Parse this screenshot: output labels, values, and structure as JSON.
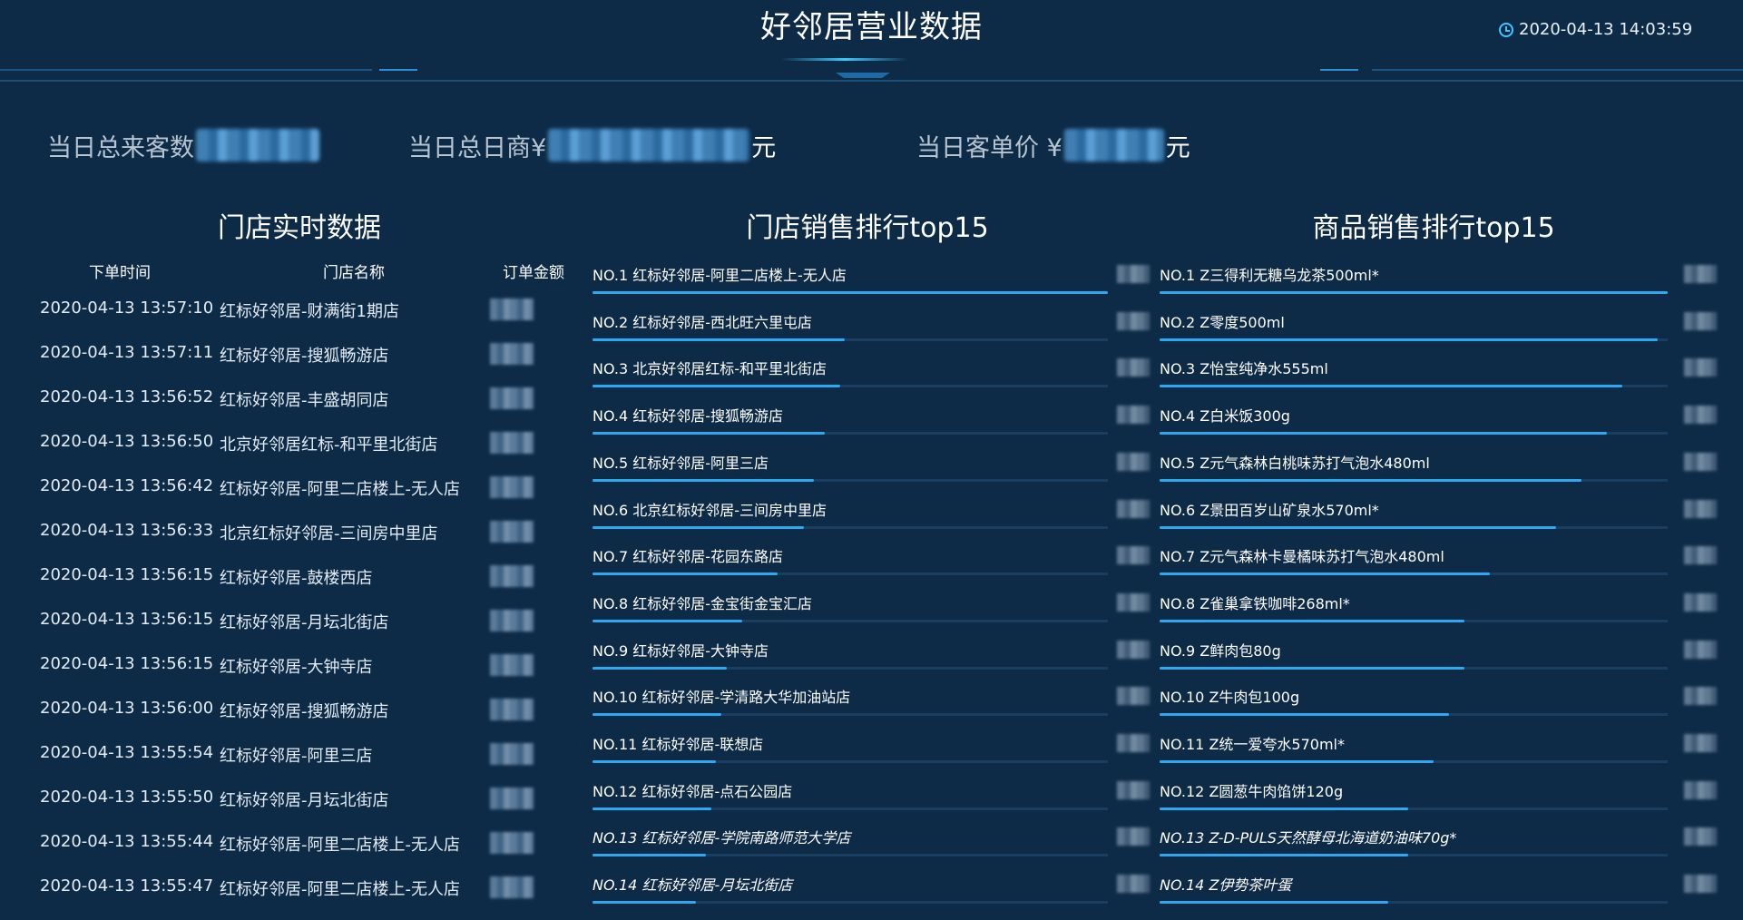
{
  "header": {
    "title": "好邻居营业数据",
    "datetime": "2020-04-13 14:03:59"
  },
  "summary": {
    "visitors_label": "当日总来客数",
    "revenue_label": "当日总日商¥",
    "revenue_unit": "元",
    "avg_label": "当日客单价 ¥",
    "avg_unit": "元"
  },
  "realtime": {
    "title": "门店实时数据",
    "columns": [
      "下单时间",
      "门店名称",
      "订单金额"
    ],
    "rows": [
      {
        "time": "2020-04-13 13:57:10",
        "store": "红标好邻居-财满街1期店"
      },
      {
        "time": "2020-04-13 13:57:11",
        "store": "红标好邻居-搜狐畅游店"
      },
      {
        "time": "2020-04-13 13:56:52",
        "store": "红标好邻居-丰盛胡同店"
      },
      {
        "time": "2020-04-13 13:56:50",
        "store": "北京好邻居红标-和平里北街店"
      },
      {
        "time": "2020-04-13 13:56:42",
        "store": "红标好邻居-阿里二店楼上-无人店"
      },
      {
        "time": "2020-04-13 13:56:33",
        "store": "北京红标好邻居-三间房中里店"
      },
      {
        "time": "2020-04-13 13:56:15",
        "store": "红标好邻居-鼓楼西店"
      },
      {
        "time": "2020-04-13 13:56:15",
        "store": "红标好邻居-月坛北街店"
      },
      {
        "time": "2020-04-13 13:56:15",
        "store": "红标好邻居-大钟寺店"
      },
      {
        "time": "2020-04-13 13:56:00",
        "store": "红标好邻居-搜狐畅游店"
      },
      {
        "time": "2020-04-13 13:55:54",
        "store": "红标好邻居-阿里三店"
      },
      {
        "time": "2020-04-13 13:55:50",
        "store": "红标好邻居-月坛北街店"
      },
      {
        "time": "2020-04-13 13:55:44",
        "store": "红标好邻居-阿里二店楼上-无人店"
      },
      {
        "time": "2020-04-13 13:55:47",
        "store": "红标好邻居-阿里二店楼上-无人店"
      }
    ]
  },
  "store_rank": {
    "title": "门店销售排行top15",
    "items": [
      {
        "label": "NO.1  红标好邻居-阿里二店楼上-无人店",
        "fill": 1.0
      },
      {
        "label": "NO.2  红标好邻居-西北旺六里屯店",
        "fill": 0.49
      },
      {
        "label": "NO.3  北京好邻居红标-和平里北街店",
        "fill": 0.48
      },
      {
        "label": "NO.4  红标好邻居-搜狐畅游店",
        "fill": 0.45
      },
      {
        "label": "NO.5  红标好邻居-阿里三店",
        "fill": 0.43
      },
      {
        "label": "NO.6  北京红标好邻居-三间房中里店",
        "fill": 0.41
      },
      {
        "label": "NO.7  红标好邻居-花园东路店",
        "fill": 0.36
      },
      {
        "label": "NO.8  红标好邻居-金宝街金宝汇店",
        "fill": 0.29
      },
      {
        "label": "NO.9  红标好邻居-大钟寺店",
        "fill": 0.26
      },
      {
        "label": "NO.10  红标好邻居-学清路大华加油站店",
        "fill": 0.25
      },
      {
        "label": "NO.11  红标好邻居-联想店",
        "fill": 0.24
      },
      {
        "label": "NO.12  红标好邻居-点石公园店",
        "fill": 0.23
      },
      {
        "label": "NO.13  红标好邻居-学院南路师范大学店",
        "fill": 0.22
      },
      {
        "label": "NO.14  红标好邻居-月坛北街店",
        "fill": 0.2
      }
    ]
  },
  "product_rank": {
    "title": "商品销售排行top15",
    "items": [
      {
        "label": "NO.1  Z三得利无糖乌龙茶500ml*",
        "fill": 1.0
      },
      {
        "label": "NO.2  Z零度500ml",
        "fill": 0.98
      },
      {
        "label": "NO.3  Z怡宝纯净水555ml",
        "fill": 0.91
      },
      {
        "label": "NO.4  Z白米饭300g",
        "fill": 0.88
      },
      {
        "label": "NO.5  Z元气森林白桃味苏打气泡水480ml",
        "fill": 0.83
      },
      {
        "label": "NO.6  Z景田百岁山矿泉水570ml*",
        "fill": 0.78
      },
      {
        "label": "NO.7  Z元气森林卡曼橘味苏打气泡水480ml",
        "fill": 0.65
      },
      {
        "label": "NO.8  Z雀巢拿铁咖啡268ml*",
        "fill": 0.6
      },
      {
        "label": "NO.9  Z鲜肉包80g",
        "fill": 0.6
      },
      {
        "label": "NO.10  Z牛肉包100g",
        "fill": 0.57
      },
      {
        "label": "NO.11  Z统一爱夸水570ml*",
        "fill": 0.54
      },
      {
        "label": "NO.12  Z圆葱牛肉馅饼120g",
        "fill": 0.49
      },
      {
        "label": "NO.13  Z-D-PULS天然酵母北海道奶油味70g*",
        "fill": 0.49
      },
      {
        "label": "NO.14  Z伊势茶叶蛋",
        "fill": 0.45
      }
    ]
  }
}
